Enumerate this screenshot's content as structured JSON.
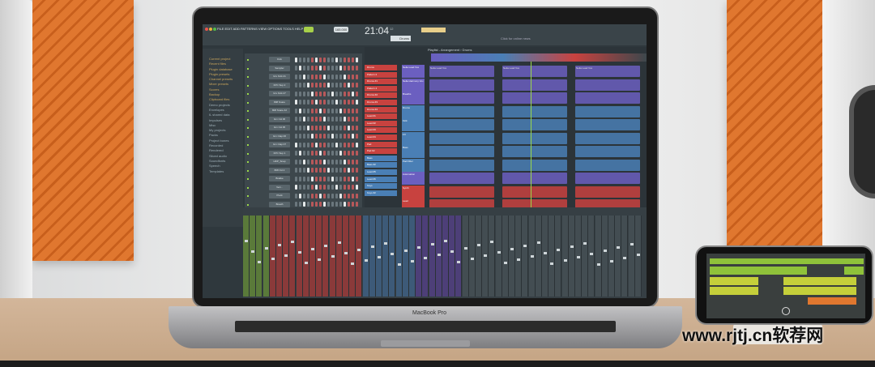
{
  "device_label": "MacBook Pro",
  "watermark": "www.rjtj.cn软荐网",
  "colors": {
    "accent_orange": "#e0772f",
    "fl_bg": "#2f383d",
    "pattern_red": "#c8423f",
    "clip_purple": "#6b5fc0",
    "clip_blue": "#4a7fb5",
    "phone_green": "#8fc23a"
  },
  "toolbar": {
    "menu": "FILE EDIT ADD PATTERNS VIEW OPTIONS TOOLS HELP",
    "tempo": "165.000",
    "time": "21:04",
    "time_sub": "12",
    "pattern": "Drums",
    "news": "Click for online news"
  },
  "browser": {
    "items": [
      "Current project",
      "Recent files",
      "Plugin database",
      "Plugin presets",
      "Channel presets",
      "Mixer presets",
      "Scores",
      "Backup",
      "Clipboard files",
      "Demo projects",
      "Envelopes",
      "IL shared data",
      "Impulses",
      "Misc",
      "My projects",
      "Packs",
      "Project bones",
      "Recorded",
      "Rendered",
      "Sliced audio",
      "Soundfonts",
      "Speech",
      "Templates"
    ]
  },
  "channel_rack": {
    "title": "Channel rack",
    "channels": [
      "Kick",
      "Sampler",
      "Grv Kick 21",
      "FPC Sup 2",
      "Grv Kick 27",
      "808 Snare",
      "808 Snare 42",
      "Grv CH 06",
      "Grv CH 05",
      "Grv Clap 06",
      "Grv Clap 07",
      "FPC Sup 1",
      "HDP_Snap",
      "808 CH 2",
      "Brakke",
      "Vert...",
      "Pluck",
      "Breath",
      "Sapler",
      "Default"
    ]
  },
  "playlist": {
    "title": "Playlist - Arrangement › Drums",
    "patterns": [
      "Drums",
      "Pattern 2",
      "Drums #1",
      "Pattern 4",
      "Drums #2",
      "Drums #3",
      "Drums #4",
      "Lead #1",
      "Lead #2",
      "Lead #3",
      "Lead #4",
      "Pad",
      "Pad #2",
      "Bass",
      "Bass #2",
      "Lead #5",
      "Lead #6",
      "Keys",
      "Keys #2"
    ],
    "tracks": [
      "Nelia Lead Vox",
      "Nelia Harmony Vox",
      "Breaths",
      "Drums",
      "Kick",
      "FX",
      "Bass",
      "Pad Filter",
      "Automation",
      "Synth",
      "Lead",
      "Arp"
    ],
    "clip_label": "Nelia Lead Vox"
  }
}
